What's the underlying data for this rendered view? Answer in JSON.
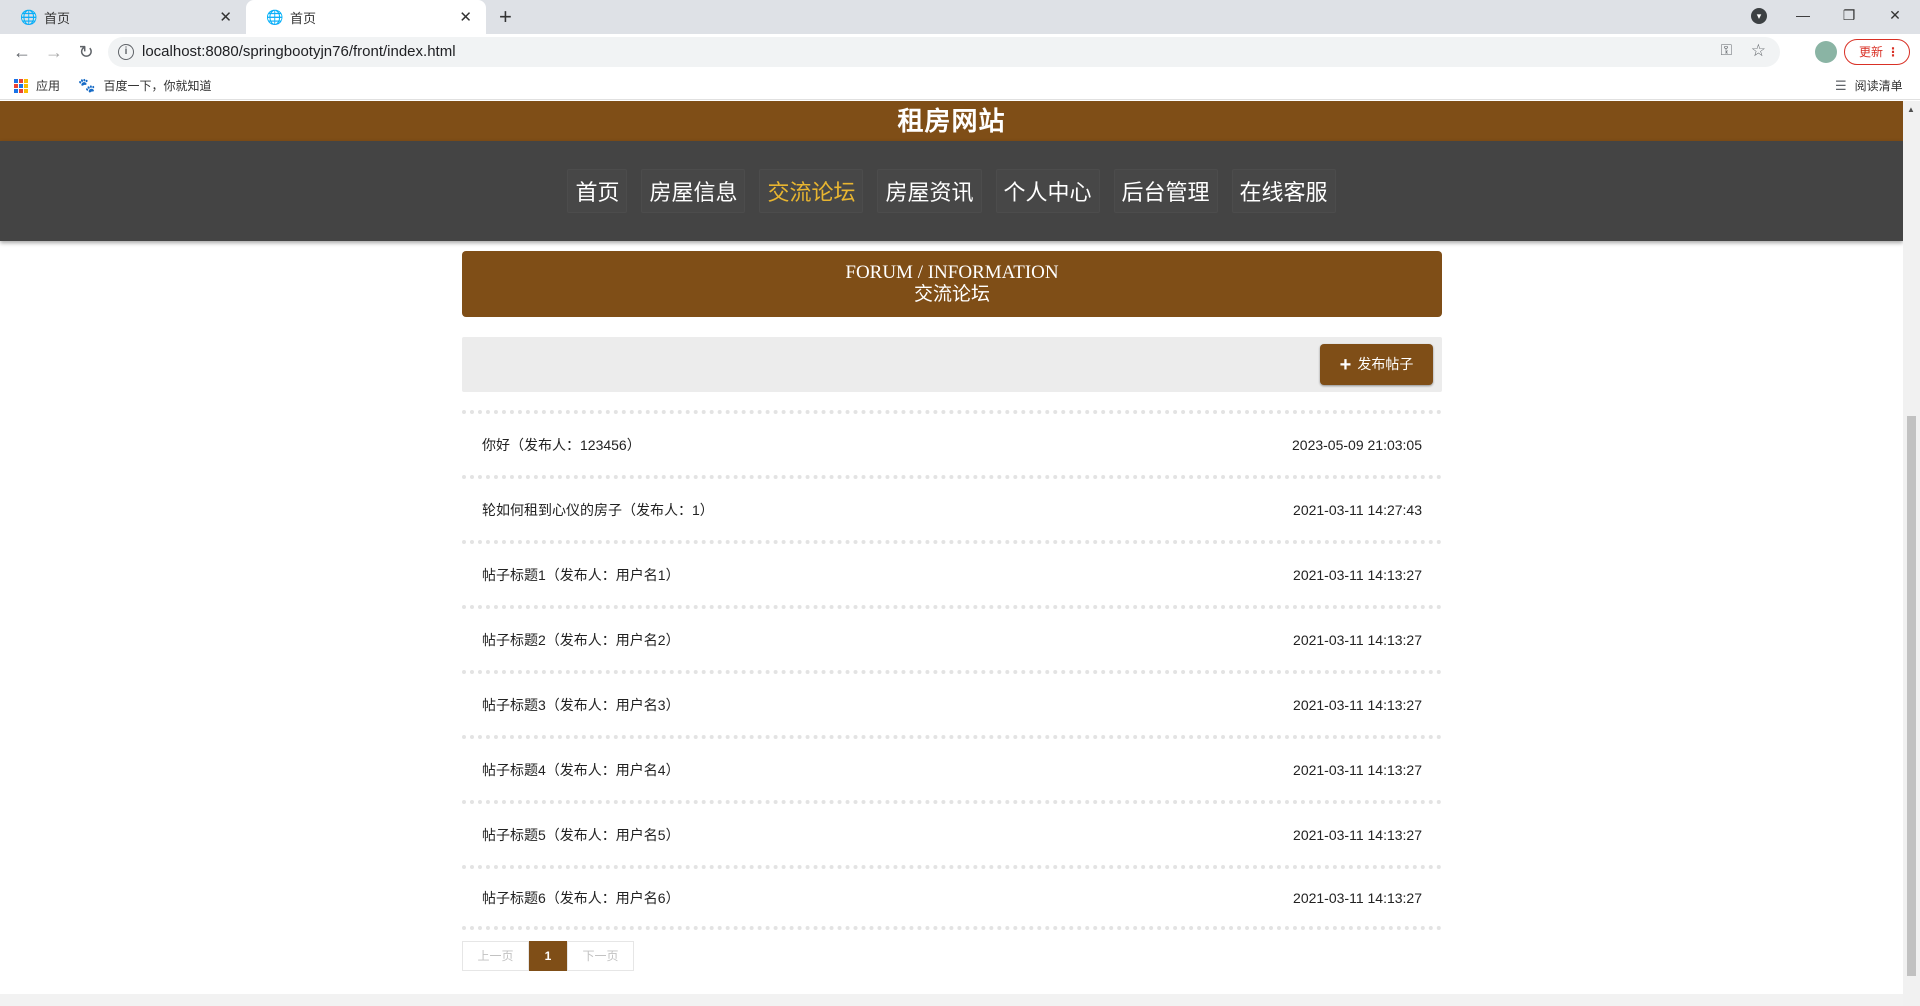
{
  "browser": {
    "tabs": [
      {
        "title": "首页",
        "active": false
      },
      {
        "title": "首页",
        "active": true
      }
    ],
    "url": "localhost:8080/springbootyjn76/front/index.html",
    "update_label": "更新",
    "bookmarks": [
      {
        "label": "应用",
        "icon": "apps-icon"
      },
      {
        "label": "百度一下，你就知道",
        "icon": "baidu-paw-icon"
      }
    ],
    "reading_list": "阅读清单"
  },
  "site": {
    "title": "租房网站",
    "menu": [
      {
        "label": "首页",
        "active": false
      },
      {
        "label": "房屋信息",
        "active": false
      },
      {
        "label": "交流论坛",
        "active": true
      },
      {
        "label": "房屋资讯",
        "active": false
      },
      {
        "label": "个人中心",
        "active": false
      },
      {
        "label": "后台管理",
        "active": false
      },
      {
        "label": "在线客服",
        "active": false
      }
    ]
  },
  "section": {
    "title_en": "FORUM / INFORMATION",
    "title_cn": "交流论坛"
  },
  "actions": {
    "post_button": "发布帖子"
  },
  "posts": [
    {
      "title": "你好（发布人：123456）",
      "time": "2023-05-09 21:03:05"
    },
    {
      "title": "轮如何租到心仪的房子（发布人：1）",
      "time": "2021-03-11 14:27:43"
    },
    {
      "title": "帖子标题1（发布人：用户名1）",
      "time": "2021-03-11 14:13:27"
    },
    {
      "title": "帖子标题2（发布人：用户名2）",
      "time": "2021-03-11 14:13:27"
    },
    {
      "title": "帖子标题3（发布人：用户名3）",
      "time": "2021-03-11 14:13:27"
    },
    {
      "title": "帖子标题4（发布人：用户名4）",
      "time": "2021-03-11 14:13:27"
    },
    {
      "title": "帖子标题5（发布人：用户名5）",
      "time": "2021-03-11 14:13:27"
    },
    {
      "title": "帖子标题6（发布人：用户名6）",
      "time": "2021-03-11 14:13:27"
    }
  ],
  "pagination": {
    "prev": "上一页",
    "current": "1",
    "next": "下一页"
  },
  "colors": {
    "brand": "#7f4e17",
    "menu_bg": "#444444",
    "menu_active": "#e8b530"
  }
}
